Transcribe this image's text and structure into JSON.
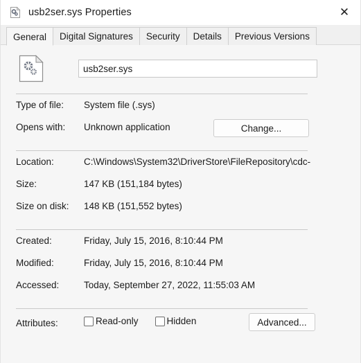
{
  "window": {
    "title": "usb2ser.sys Properties",
    "icon": "system-file-gears-icon",
    "close_label": "✕"
  },
  "tabs": [
    {
      "label": "General",
      "active": true
    },
    {
      "label": "Digital Signatures",
      "active": false
    },
    {
      "label": "Security",
      "active": false
    },
    {
      "label": "Details",
      "active": false
    },
    {
      "label": "Previous Versions",
      "active": false
    }
  ],
  "general": {
    "file_icon": "system-file-gears-icon",
    "filename_value": "usb2ser.sys",
    "filename_placeholder": "",
    "rows": [
      {
        "label": "Type of file:",
        "value": "System file (.sys)"
      },
      {
        "label": "Opens with:",
        "value": "Unknown application"
      },
      {
        "label": "Location:",
        "value": "C:\\Windows\\System32\\DriverStore\\FileRepository\\cdc-"
      },
      {
        "label": "Size:",
        "value": "147 KB (151,184 bytes)"
      },
      {
        "label": "Size on disk:",
        "value": "148 KB (151,552 bytes)"
      },
      {
        "label": "Created:",
        "value": "Friday, July 15, 2016, 8:10:44 PM"
      },
      {
        "label": "Modified:",
        "value": "Friday, July 15, 2016, 8:10:44 PM"
      },
      {
        "label": "Accessed:",
        "value": "Today, September 27, 2022, 11:55:03 AM"
      },
      {
        "label": "Attributes:",
        "value": ""
      }
    ],
    "change_button": "Change...",
    "advanced_button": "Advanced...",
    "attributes": [
      {
        "label": "Read-only",
        "checked": false
      },
      {
        "label": "Hidden",
        "checked": false
      }
    ]
  },
  "colors": {
    "window_bg": "#f6f6f6",
    "titlebar_bg": "#ffffff",
    "tabstrip_bg": "#f0f0f0",
    "text": "#1b1b1b",
    "separator": "#c9c9c9",
    "button_border": "#cccccc",
    "input_border": "#c8c8c8",
    "icon_gear": "#6b7280"
  }
}
